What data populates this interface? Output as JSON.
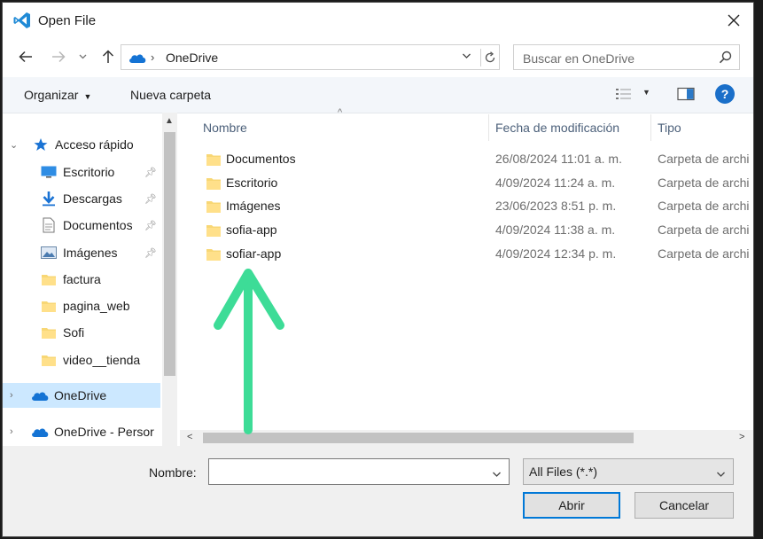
{
  "window": {
    "title": "Open File",
    "icon": "vscode-icon",
    "close_icon": "close-icon"
  },
  "address": {
    "location_icon": "onedrive-cloud-icon",
    "separator": "›",
    "path": "OneDrive",
    "dropdown_icon": "chevron-down-icon",
    "refresh_icon": "refresh-icon"
  },
  "nav_buttons": {
    "back_icon": "back-arrow-icon",
    "forward_icon": "forward-arrow-icon",
    "recent_icon": "chevron-down-icon",
    "up_icon": "up-arrow-icon"
  },
  "search": {
    "placeholder": "Buscar en OneDrive",
    "icon": "search-icon"
  },
  "toolbar": {
    "organize": "Organizar",
    "new_folder": "Nueva carpeta",
    "view_icon": "view-details-icon",
    "preview_icon": "preview-pane-icon",
    "help_icon": "help-icon",
    "help_glyph": "?"
  },
  "sidebar": {
    "items": [
      {
        "label": "Acceso rápido",
        "icon": "star-icon",
        "expandable": true,
        "pinned": false
      },
      {
        "label": "Escritorio",
        "icon": "desktop-icon",
        "pinned": true
      },
      {
        "label": "Descargas",
        "icon": "download-arrow-icon",
        "pinned": true
      },
      {
        "label": "Documentos",
        "icon": "document-icon",
        "pinned": true
      },
      {
        "label": "Imágenes",
        "icon": "pictures-icon",
        "pinned": true
      },
      {
        "label": "factura",
        "icon": "folder-icon",
        "pinned": false
      },
      {
        "label": "pagina_web",
        "icon": "folder-icon",
        "pinned": false
      },
      {
        "label": "Sofi",
        "icon": "folder-icon",
        "pinned": false
      },
      {
        "label": "video__tienda",
        "icon": "folder-icon",
        "pinned": false
      },
      {
        "label": "OneDrive",
        "icon": "onedrive-cloud-icon",
        "selected": true
      },
      {
        "label": "OneDrive - Persor",
        "icon": "onedrive-cloud-icon"
      }
    ]
  },
  "file_list": {
    "columns": [
      "Nombre",
      "Fecha de modificación",
      "Tipo"
    ],
    "rows": [
      {
        "name": "Documentos",
        "date": "26/08/2024 11:01 a. m.",
        "type": "Carpeta de archi"
      },
      {
        "name": "Escritorio",
        "date": "4/09/2024 11:24 a. m.",
        "type": "Carpeta de archi"
      },
      {
        "name": "Imágenes",
        "date": "23/06/2023 8:51 p. m.",
        "type": "Carpeta de archi"
      },
      {
        "name": "sofia-app",
        "date": "4/09/2024 11:38 a. m.",
        "type": "Carpeta de archi"
      },
      {
        "name": "sofiar-app",
        "date": "4/09/2024 12:34 p. m.",
        "type": "Carpeta de archi"
      }
    ]
  },
  "footer": {
    "filename_label": "Nombre:",
    "filename_value": "",
    "filetype_value": "All Files (*.*)",
    "open_button": "Abrir",
    "cancel_button": "Cancelar"
  },
  "annotation": {
    "arrow_color": "#3ddc97"
  },
  "colors": {
    "selection": "#cce8ff",
    "accent": "#0078d7",
    "folder": "#f8d775"
  }
}
